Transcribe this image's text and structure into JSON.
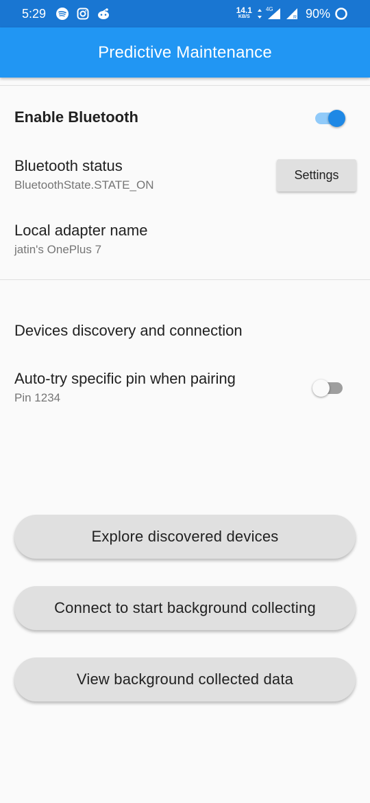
{
  "status_bar": {
    "time": "5:29",
    "icons": [
      "spotify-icon",
      "instagram-icon",
      "reddit-icon"
    ],
    "net_speed_value": "14.1",
    "net_speed_unit": "KB/S",
    "network_type": "4G",
    "battery": "90%"
  },
  "app_bar": {
    "title": "Predictive Maintenance"
  },
  "bluetooth": {
    "enable_label": "Enable Bluetooth",
    "enabled": true,
    "status_label": "Bluetooth status",
    "status_value": "BluetoothState.STATE_ON",
    "settings_button": "Settings",
    "adapter_label": "Local adapter name",
    "adapter_value": "jatin's OnePlus 7"
  },
  "discovery": {
    "section_title": "Devices discovery and connection",
    "autopin_label": "Auto-try specific pin when pairing",
    "autopin_sub": "Pin 1234",
    "autopin_enabled": false
  },
  "actions": {
    "explore": "Explore discovered devices",
    "connect": "Connect to start background collecting",
    "view": "View background collected data"
  },
  "colors": {
    "status_bar": "#1976d2",
    "app_bar": "#2196f3",
    "switch_on": "#1e88e5",
    "switch_track_on": "#90caf9",
    "button_bg": "#e0e0e0"
  }
}
